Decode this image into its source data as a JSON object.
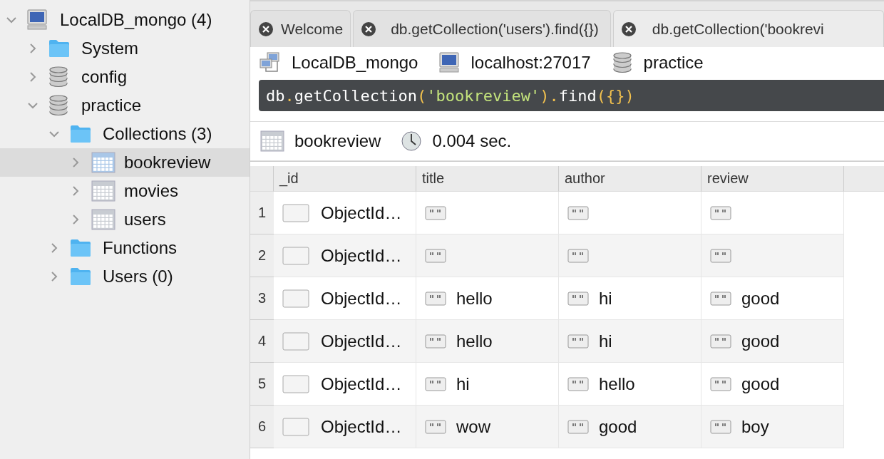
{
  "tree": [
    {
      "label": "LocalDB_mongo (4)",
      "kind": "server",
      "expanded": true,
      "selected": false,
      "children": [
        {
          "label": "System",
          "kind": "folder",
          "expanded": false,
          "selected": false
        },
        {
          "label": "config",
          "kind": "database",
          "expanded": false,
          "selected": false
        },
        {
          "label": "practice",
          "kind": "database",
          "expanded": true,
          "selected": false,
          "children": [
            {
              "label": "Collections (3)",
              "kind": "folder",
              "expanded": true,
              "selected": false,
              "children": [
                {
                  "label": "bookreview",
                  "kind": "collection",
                  "expanded": false,
                  "selected": true
                },
                {
                  "label": "movies",
                  "kind": "collection",
                  "expanded": false,
                  "selected": false
                },
                {
                  "label": "users",
                  "kind": "collection",
                  "expanded": false,
                  "selected": false
                }
              ]
            },
            {
              "label": "Functions",
              "kind": "folder",
              "expanded": false,
              "selected": false
            },
            {
              "label": "Users (0)",
              "kind": "folder",
              "expanded": false,
              "selected": false
            }
          ]
        }
      ]
    }
  ],
  "tabs": [
    {
      "label": "Welcome",
      "selected": false
    },
    {
      "label": "db.getCollection('users').find({})",
      "selected": false
    },
    {
      "label": "db.getCollection('bookrevi",
      "selected": true
    }
  ],
  "connection": {
    "server": "LocalDB_mongo",
    "host": "localhost:27017",
    "database": "practice"
  },
  "query": [
    {
      "text": "db",
      "kind": "plain"
    },
    {
      "text": ".",
      "kind": "punct"
    },
    {
      "text": "getCollection",
      "kind": "plain"
    },
    {
      "text": "(",
      "kind": "punct"
    },
    {
      "text": "'bookreview'",
      "kind": "string"
    },
    {
      "text": ")",
      "kind": "punct"
    },
    {
      "text": ".",
      "kind": "punct"
    },
    {
      "text": "find",
      "kind": "plain"
    },
    {
      "text": "(",
      "kind": "punct"
    },
    {
      "text": "{",
      "kind": "punct"
    },
    {
      "text": "}",
      "kind": "punct"
    },
    {
      "text": ")",
      "kind": "punct"
    }
  ],
  "result": {
    "collection": "bookreview",
    "time": "0.004 sec."
  },
  "table": {
    "columns": [
      "_id",
      "title",
      "author",
      "review"
    ],
    "rows": [
      {
        "number": "1",
        "cells": [
          {
            "kind": "objectid",
            "value": "ObjectId…"
          },
          {
            "kind": "string"
          },
          {
            "kind": "string"
          },
          {
            "kind": "string"
          }
        ]
      },
      {
        "number": "2",
        "cells": [
          {
            "kind": "objectid",
            "value": "ObjectId…"
          },
          {
            "kind": "string"
          },
          {
            "kind": "string"
          },
          {
            "kind": "string"
          }
        ]
      },
      {
        "number": "3",
        "cells": [
          {
            "kind": "objectid",
            "value": "ObjectId…"
          },
          {
            "kind": "string",
            "value": "hello"
          },
          {
            "kind": "string",
            "value": "hi"
          },
          {
            "kind": "string",
            "value": "good"
          }
        ]
      },
      {
        "number": "4",
        "cells": [
          {
            "kind": "objectid",
            "value": "ObjectId…"
          },
          {
            "kind": "string",
            "value": "hello"
          },
          {
            "kind": "string",
            "value": "hi"
          },
          {
            "kind": "string",
            "value": "good"
          }
        ]
      },
      {
        "number": "5",
        "cells": [
          {
            "kind": "objectid",
            "value": "ObjectId…"
          },
          {
            "kind": "string",
            "value": "hi"
          },
          {
            "kind": "string",
            "value": "hello"
          },
          {
            "kind": "string",
            "value": "good"
          }
        ]
      },
      {
        "number": "6",
        "cells": [
          {
            "kind": "objectid",
            "value": "ObjectId…"
          },
          {
            "kind": "string",
            "value": "wow"
          },
          {
            "kind": "string",
            "value": "good"
          },
          {
            "kind": "string",
            "value": "boy"
          }
        ]
      }
    ]
  }
}
